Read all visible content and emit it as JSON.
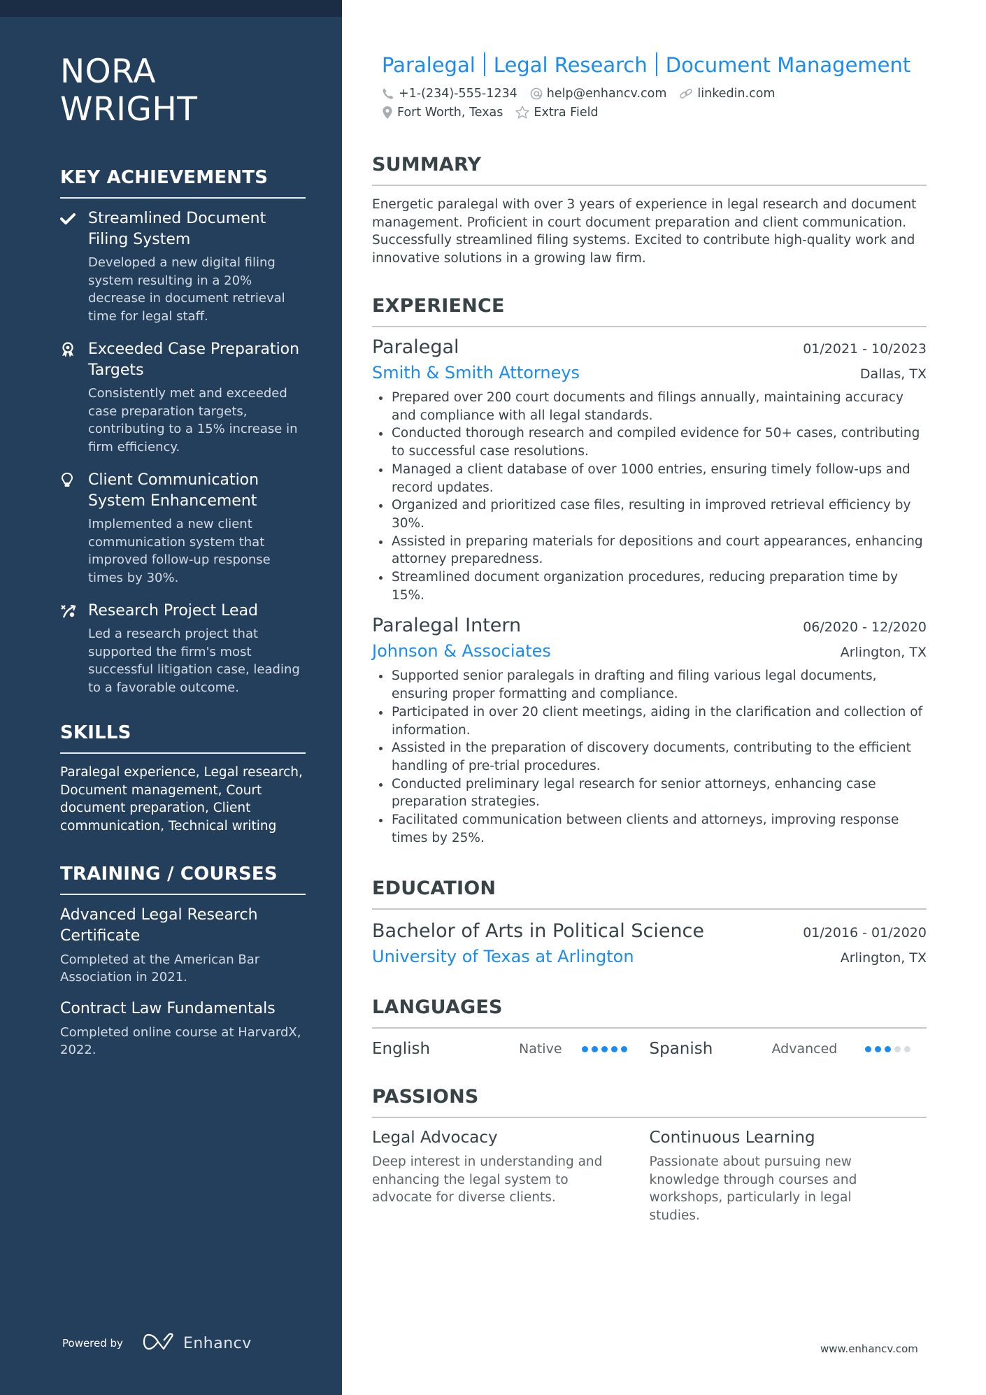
{
  "profile": {
    "first_name": "NORA",
    "last_name": "WRIGHT",
    "headline": [
      "Paralegal",
      "Legal Research",
      "Document Management"
    ],
    "contacts": {
      "phone": "+1-(234)-555-1234",
      "email": "help@enhancv.com",
      "linkedin": "linkedin.com",
      "location": "Fort Worth, Texas",
      "extra": "Extra Field"
    }
  },
  "sidebar": {
    "achievements": {
      "heading": "KEY ACHIEVEMENTS",
      "items": [
        {
          "icon": "check-icon",
          "title": "Streamlined Document Filing System",
          "desc": "Developed a new digital filing system resulting in a 20% decrease in document retrieval time for legal staff."
        },
        {
          "icon": "award-ribbon-icon",
          "title": "Exceeded Case Preparation Targets",
          "desc": "Consistently met and exceeded case preparation targets, contributing to a 15% increase in firm efficiency."
        },
        {
          "icon": "lightbulb-icon",
          "title": "Client Communication System Enhancement",
          "desc": "Implemented a new client communication system that improved follow-up response times by 30%."
        },
        {
          "icon": "strategy-play-icon",
          "title": "Research Project Lead",
          "desc": "Led a research project that supported the firm's most successful litigation case, leading to a favorable outcome."
        }
      ]
    },
    "skills": {
      "heading": "SKILLS",
      "text": "Paralegal experience, Legal research, Document management, Court document preparation, Client communication, Technical writing"
    },
    "training": {
      "heading": "TRAINING / COURSES",
      "items": [
        {
          "title": "Advanced Legal Research Certificate",
          "desc": "Completed at the American Bar Association in 2021."
        },
        {
          "title": "Contract Law Fundamentals",
          "desc": "Completed online course at HarvardX, 2022."
        }
      ]
    },
    "footer": {
      "powered_by": "Powered by",
      "brand": "Enhancv"
    }
  },
  "main": {
    "summary": {
      "heading": "SUMMARY",
      "text": "Energetic paralegal with over 3 years of experience in legal research and document management. Proficient in court document preparation and client communication. Successfully streamlined filing systems. Excited to contribute high-quality work and innovative solutions in a growing law firm."
    },
    "experience": {
      "heading": "EXPERIENCE",
      "jobs": [
        {
          "title": "Paralegal",
          "dates": "01/2021 - 10/2023",
          "company": "Smith & Smith Attorneys",
          "location": "Dallas, TX",
          "bullets": [
            "Prepared over 200 court documents and filings annually, maintaining accuracy and compliance with all legal standards.",
            "Conducted thorough research and compiled evidence for 50+ cases, contributing to successful case resolutions.",
            "Managed a client database of over 1000 entries, ensuring timely follow-ups and record updates.",
            "Organized and prioritized case files, resulting in improved retrieval efficiency by 30%.",
            "Assisted in preparing materials for depositions and court appearances, enhancing attorney preparedness.",
            "Streamlined document organization procedures, reducing preparation time by 15%."
          ]
        },
        {
          "title": "Paralegal Intern",
          "dates": "06/2020 - 12/2020",
          "company": "Johnson & Associates",
          "location": "Arlington, TX",
          "bullets": [
            "Supported senior paralegals in drafting and filing various legal documents, ensuring proper formatting and compliance.",
            "Participated in over 20 client meetings, aiding in the clarification and collection of information.",
            "Assisted in the preparation of discovery documents, contributing to the efficient handling of pre-trial procedures.",
            "Conducted preliminary legal research for senior attorneys, enhancing case preparation strategies.",
            "Facilitated communication between clients and attorneys, improving response times by 25%."
          ]
        }
      ]
    },
    "education": {
      "heading": "EDUCATION",
      "items": [
        {
          "degree": "Bachelor of Arts in Political Science",
          "dates": "01/2016 - 01/2020",
          "school": "University of Texas at Arlington",
          "location": "Arlington, TX"
        }
      ]
    },
    "languages": {
      "heading": "LANGUAGES",
      "items": [
        {
          "name": "English",
          "level": "Native",
          "rating": 5,
          "max": 5
        },
        {
          "name": "Spanish",
          "level": "Advanced",
          "rating": 3,
          "max": 5
        }
      ]
    },
    "passions": {
      "heading": "PASSIONS",
      "items": [
        {
          "title": "Legal Advocacy",
          "desc": "Deep interest in understanding and enhancing the legal system to advocate for diverse clients."
        },
        {
          "title": "Continuous Learning",
          "desc": "Passionate about pursuing new knowledge through courses and workshops, particularly in legal studies."
        }
      ]
    }
  },
  "footer": {
    "website": "www.enhancv.com"
  },
  "colors": {
    "sidebar": "#243f5c",
    "sidebar_strip": "#1b2d45",
    "accent": "#1a8cf0",
    "text": "#384347"
  }
}
